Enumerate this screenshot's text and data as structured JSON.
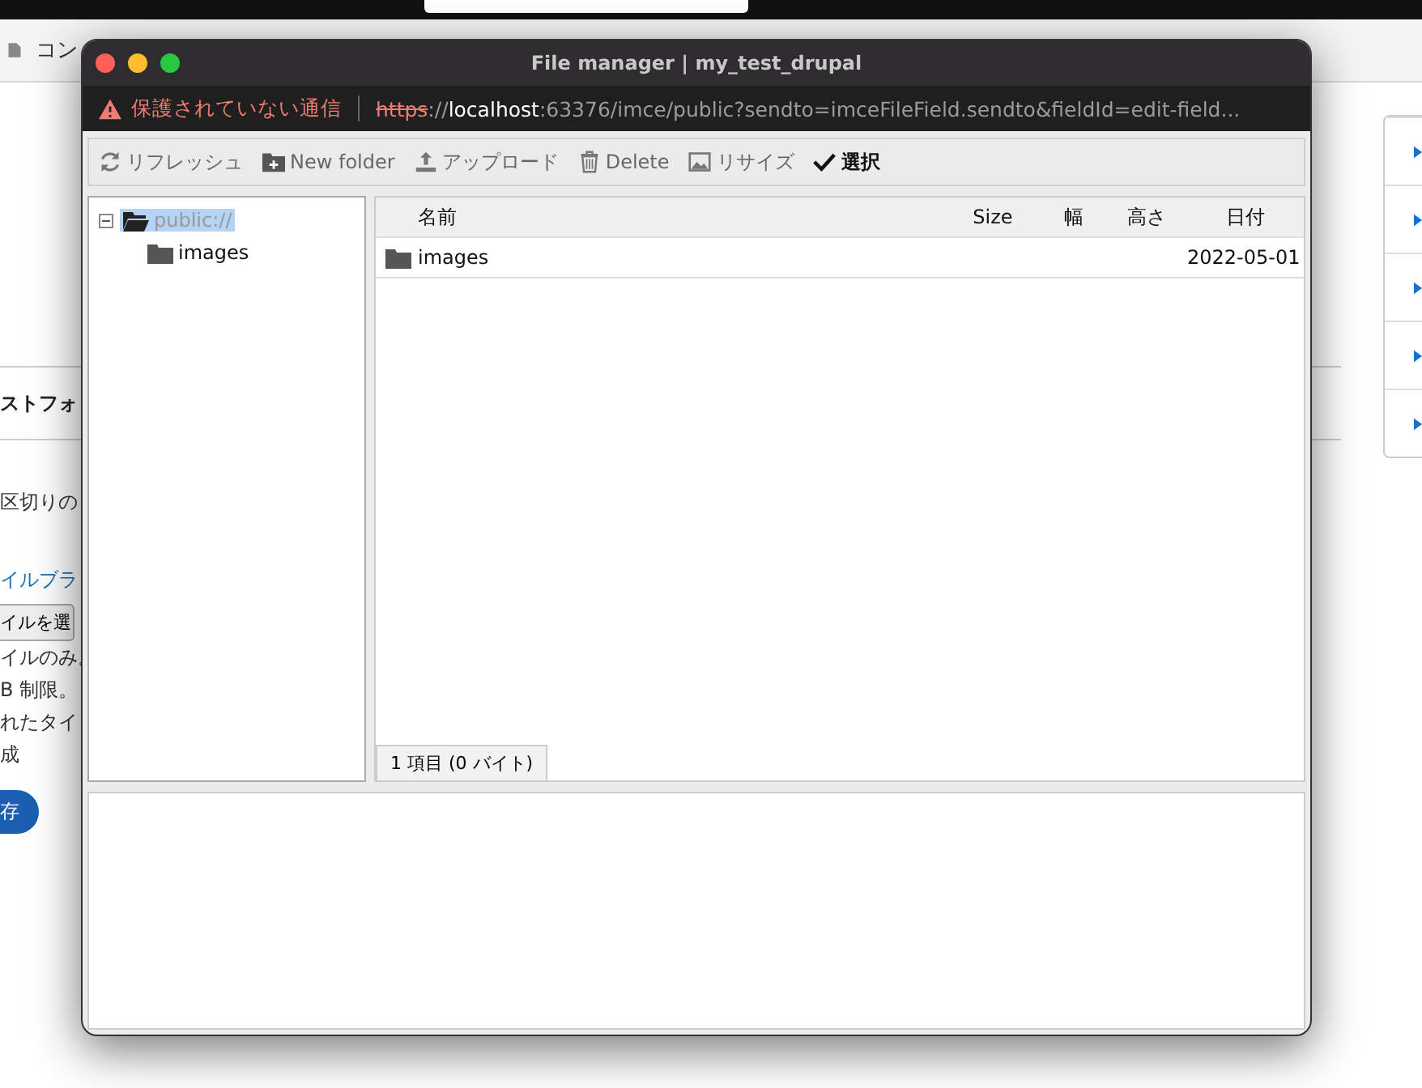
{
  "background": {
    "tab_label": "コン",
    "texts": [
      {
        "kind": "heading",
        "text": "ストフォ"
      },
      {
        "kind": "plain",
        "text": "区切りの"
      },
      {
        "kind": "link",
        "text": "イルブラ"
      },
      {
        "kind": "button",
        "text": "イルを選"
      },
      {
        "kind": "plain",
        "text": "イルのみ。"
      },
      {
        "kind": "plain",
        "text": "B 制限。"
      },
      {
        "kind": "plain",
        "text": "れたタイ"
      },
      {
        "kind": "plain",
        "text": "成"
      },
      {
        "kind": "primary",
        "text": "存"
      }
    ]
  },
  "window": {
    "title": "File manager | my_test_drupal",
    "address": {
      "warning": "保護されていない通信",
      "scheme": "https",
      "separator": "://",
      "host": "localhost",
      "path": ":63376/imce/public?sendto=imceFileField.sendto&fieldId=edit-field..."
    },
    "toolbar": [
      {
        "kind": "refresh",
        "label": "リフレッシュ",
        "primary": false
      },
      {
        "kind": "new-folder",
        "label": "New folder",
        "primary": false
      },
      {
        "kind": "upload",
        "label": "アップロード",
        "primary": false
      },
      {
        "kind": "delete",
        "label": "Delete",
        "primary": false
      },
      {
        "kind": "resize",
        "label": "リサイズ",
        "primary": false
      },
      {
        "kind": "select",
        "label": "選択",
        "primary": true
      }
    ],
    "tree": [
      {
        "label": "public://",
        "expanded": true,
        "selected": true,
        "children": [
          {
            "label": "images",
            "selected": false
          }
        ]
      }
    ],
    "table": {
      "columns": [
        "名前",
        "Size",
        "幅",
        "高さ",
        "日付"
      ],
      "rows": [
        {
          "kind": "folder",
          "name": "images",
          "date": "2022-05-01"
        }
      ]
    },
    "status": "1 項目 (0 バイト)"
  }
}
